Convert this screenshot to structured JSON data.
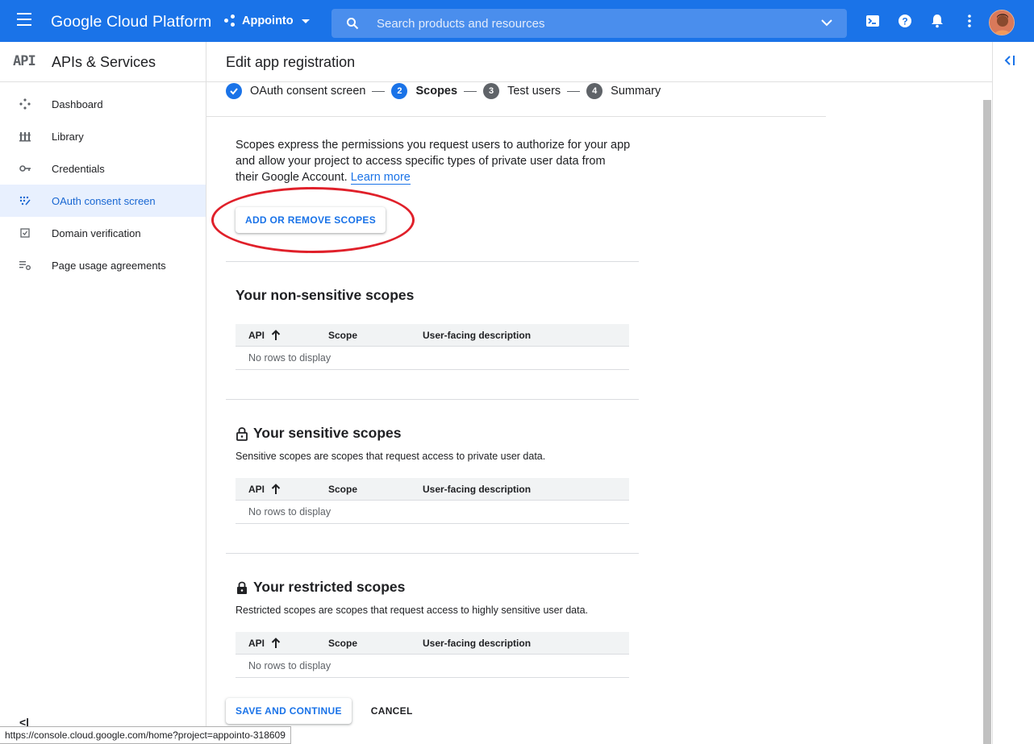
{
  "topbar": {
    "brand": "Google Cloud Platform",
    "project_name": "Appointo",
    "search_placeholder": "Search products and resources"
  },
  "sidebar": {
    "logo": "API",
    "title": "APIs & Services",
    "items": [
      {
        "label": "Dashboard",
        "icon": "dashboard-icon"
      },
      {
        "label": "Library",
        "icon": "library-icon"
      },
      {
        "label": "Credentials",
        "icon": "key-icon"
      },
      {
        "label": "OAuth consent screen",
        "icon": "oauth-icon",
        "active": true
      },
      {
        "label": "Domain verification",
        "icon": "checkbox-icon"
      },
      {
        "label": "Page usage agreements",
        "icon": "settings-list-icon"
      }
    ],
    "collapse_label": "<|"
  },
  "main": {
    "title": "Edit app registration",
    "steps": [
      {
        "number": "",
        "label": "OAuth consent screen",
        "state": "done"
      },
      {
        "number": "2",
        "label": "Scopes",
        "state": "current"
      },
      {
        "number": "3",
        "label": "Test users",
        "state": "pending"
      },
      {
        "number": "4",
        "label": "Summary",
        "state": "pending"
      }
    ],
    "intro_text": "Scopes express the permissions you request users to authorize for your app and allow your project to access specific types of private user data from their Google Account.",
    "learn_more": "Learn more",
    "add_remove_button": "ADD OR REMOVE SCOPES",
    "sections": [
      {
        "title": "Your non-sensitive scopes",
        "description": "",
        "lock": "none"
      },
      {
        "title": "Your sensitive scopes",
        "description": "Sensitive scopes are scopes that request access to private user data.",
        "lock": "open"
      },
      {
        "title": "Your restricted scopes",
        "description": "Restricted scopes are scopes that request access to highly sensitive user data.",
        "lock": "closed"
      }
    ],
    "table_headers": {
      "api": "API",
      "scope": "Scope",
      "description": "User-facing description"
    },
    "empty_text": "No rows to display",
    "save_button": "SAVE AND CONTINUE",
    "cancel_button": "CANCEL"
  },
  "statusbar": {
    "url": "https://console.cloud.google.com/home?project=appointo-318609"
  },
  "colors": {
    "brand_blue": "#1a73e8",
    "step_pending": "#5f6368",
    "highlight": "#e0202a"
  }
}
